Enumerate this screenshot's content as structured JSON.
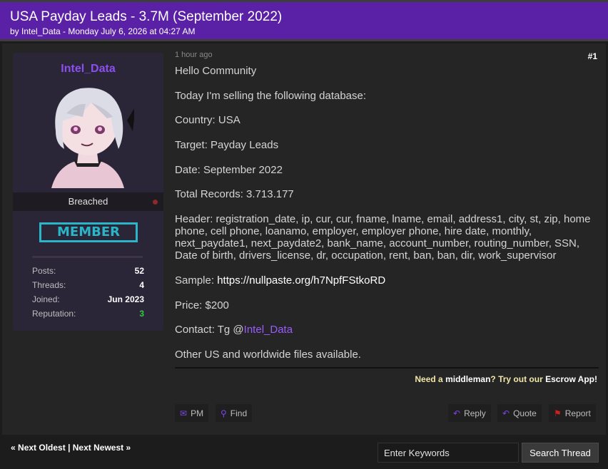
{
  "thread": {
    "title": "USA Payday Leads - 3.7M (September 2022)",
    "meta": "by Intel_Data - Monday July 6, 2026 at 04:27 AM"
  },
  "author": {
    "name": "Intel_Data",
    "usertitle": "Breached",
    "group_badge": "MEMBER",
    "stats": [
      {
        "label": "Posts:",
        "value": "52"
      },
      {
        "label": "Threads:",
        "value": "4"
      },
      {
        "label": "Joined:",
        "value": "Jun 2023"
      },
      {
        "label": "Reputation:",
        "value": "3"
      }
    ]
  },
  "post": {
    "time": "1 hour ago",
    "number": "#1",
    "lines": {
      "greeting": "Hello Community",
      "intro": "Today I'm selling the following database:",
      "country": "Country: USA",
      "target": "Target: Payday Leads",
      "date": "Date: September 2022",
      "records": "Total Records: 3.713.177",
      "header": "Header: registration_date, ip, cur, cur, fname, lname, email, address1, city, st, zip, home phone, cell phone, loanamo, employer, employer phone, hire date, monthly, next_paydate1, next_paydate2, bank_name, account_number, routing_number, SSN, Date of birth, drivers_license, dr, occupation, rent, ban, ban, dir, work_supervisor",
      "sample_label": "Sample: ",
      "sample_link": "https://nullpaste.org/h7NpfFStkoRD",
      "price": "Price: $200",
      "contact_label": "Contact: Tg @",
      "contact_handle": "Intel_Data",
      "other": "Other US and worldwide files available."
    }
  },
  "signature": {
    "pre": "Need a ",
    "middleman": "middleman",
    "mid": "? Try out our ",
    "escrow": "Escrow App!"
  },
  "buttons": {
    "pm": "PM",
    "find": "Find",
    "reply": "Reply",
    "quote": "Quote",
    "report": "Report"
  },
  "navigation": {
    "prev_arrow": "«",
    "next_oldest": "Next Oldest",
    "separator": "|",
    "next_newest": "Next Newest",
    "next_arrow": "»"
  },
  "search": {
    "placeholder": "Enter Keywords",
    "button": "Search Thread"
  },
  "icons": {
    "pm": "envelope-icon",
    "find": "search-icon",
    "reply": "reply-icon",
    "quote": "reply-all-icon",
    "report": "flag-icon"
  },
  "colors": {
    "header_bg": "#5a21a6",
    "accent": "#8b4ff0",
    "badge": "#2bb5c9",
    "reputation": "#2ecc40",
    "report": "#d01f1f"
  }
}
